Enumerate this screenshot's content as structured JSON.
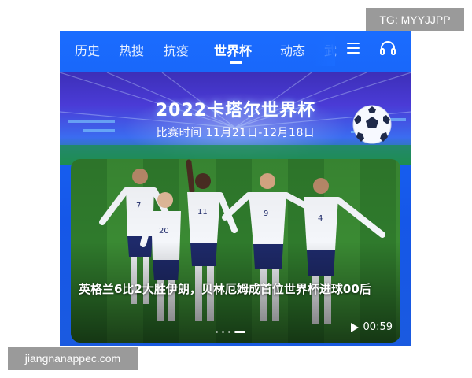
{
  "watermarks": {
    "top_right": "TG: MYYJJPP",
    "bottom_left": "jiangnanappec.com"
  },
  "nav": {
    "tabs": [
      {
        "label": "历史"
      },
      {
        "label": "热搜"
      },
      {
        "label": "抗疫"
      },
      {
        "label": "世界杯",
        "active": true
      },
      {
        "label": "动态"
      },
      {
        "label": "武"
      }
    ],
    "menu_icon": "hamburger-menu-icon",
    "support_icon": "headset-icon"
  },
  "banner": {
    "title": "2022卡塔尔世界杯",
    "dates": "比赛时间 11月21日-12月18日",
    "icon": "soccer-ball-icon"
  },
  "video": {
    "caption": "英格兰6比2大胜伊朗，贝林厄姆成首位世界杯进球00后",
    "duration": "00:59",
    "page_count": 4,
    "active_page": 4,
    "player_numbers": [
      "7",
      "20",
      "11",
      "9",
      "4"
    ]
  },
  "colors": {
    "primary_blue": "#1a6cff",
    "pitch_green": "#2f7a2c",
    "kit_white": "#f4f6fa",
    "kit_navy": "#1e2a6a"
  }
}
